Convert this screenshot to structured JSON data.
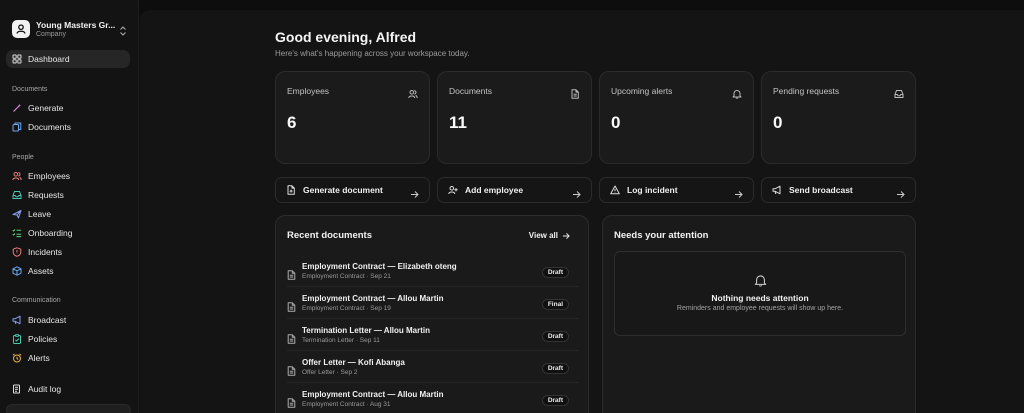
{
  "company": {
    "name": "Young Masters Gr...",
    "type": "Company"
  },
  "sidebar": {
    "dashboard": "Dashboard",
    "sections": {
      "documents": "Documents",
      "people": "People",
      "communication": "Communication"
    },
    "documents_items": [
      "Generate",
      "Documents"
    ],
    "people_items": [
      "Employees",
      "Requests",
      "Leave",
      "Onboarding",
      "Incidents",
      "Assets"
    ],
    "communication_items": [
      "Broadcast",
      "Policies",
      "Alerts"
    ],
    "audit_log": "Audit log"
  },
  "header": {
    "greeting": "Good evening, Alfred",
    "subtitle": "Here's what's happening across your workspace today."
  },
  "stats": [
    {
      "label": "Employees",
      "value": "6",
      "icon": "users-icon"
    },
    {
      "label": "Documents",
      "value": "11",
      "icon": "file-icon"
    },
    {
      "label": "Upcoming alerts",
      "value": "0",
      "icon": "bell-icon"
    },
    {
      "label": "Pending requests",
      "value": "0",
      "icon": "inbox-icon"
    }
  ],
  "actions": [
    {
      "label": "Generate document",
      "icon": "file-plus-icon"
    },
    {
      "label": "Add employee",
      "icon": "user-plus-icon"
    },
    {
      "label": "Log incident",
      "icon": "warning-icon"
    },
    {
      "label": "Send broadcast",
      "icon": "megaphone-icon"
    }
  ],
  "recent_documents": {
    "title": "Recent documents",
    "view_all": "View all",
    "items": [
      {
        "title": "Employment Contract — Elizabeth oteng",
        "meta": "Employment Contract · Sep 21",
        "status": "Draft"
      },
      {
        "title": "Employment Contract — Allou Martin",
        "meta": "Employment Contract · Sep 19",
        "status": "Final"
      },
      {
        "title": "Termination Letter — Allou Martin",
        "meta": "Termination Letter · Sep 11",
        "status": "Draft"
      },
      {
        "title": "Offer Letter — Kofi Abanga",
        "meta": "Offer Letter · Sep 2",
        "status": "Draft"
      },
      {
        "title": "Employment Contract — Allou Martin",
        "meta": "Employment Contract · Aug 31",
        "status": "Draft"
      }
    ]
  },
  "attention": {
    "title": "Needs your attention",
    "empty_title": "Nothing needs attention",
    "empty_sub": "Reminders and employee requests will show up here."
  },
  "colors": {
    "background": "#0d0d0d",
    "sidebar": "#131313",
    "card": "#1b1b1b",
    "border": "#2b2b2b",
    "text": "#f2f2f2",
    "muted": "#9c9c9c"
  }
}
